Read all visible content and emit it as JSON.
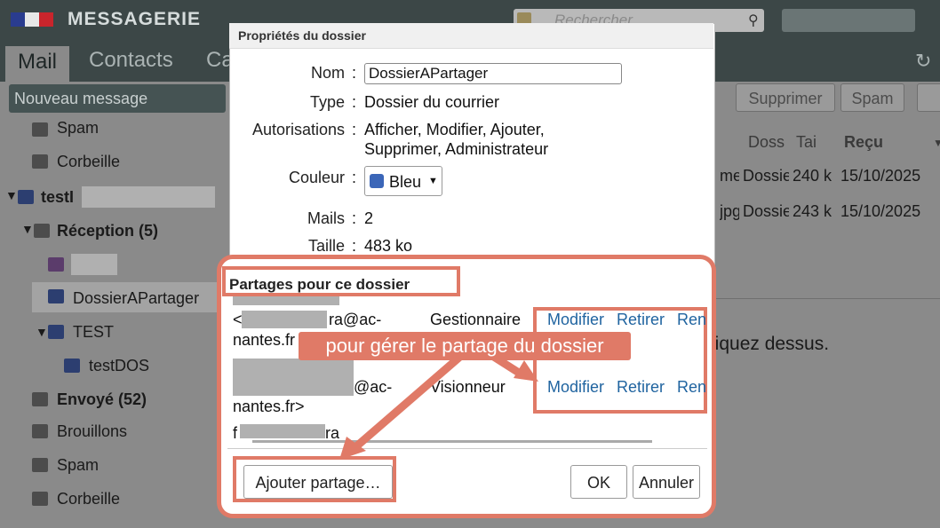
{
  "header": {
    "app_title": "MESSAGERIE",
    "search_placeholder": "Rechercher",
    "tabs": [
      {
        "label": "Mail"
      },
      {
        "label": "Contacts"
      },
      {
        "label": "Ca"
      }
    ],
    "refresh_icon": "refresh-icon"
  },
  "toolbar": {
    "compose_label": "Nouveau message",
    "delete_label": "Supprimer",
    "spam_label": "Spam"
  },
  "folders": {
    "spam_top": "Spam",
    "trash_top": "Corbeille",
    "account_label": "testI",
    "inbox_label": "Réception (5)",
    "shared_folder": "DossierAPartager",
    "test_folder": "TEST",
    "test_sub": "testDOS",
    "sent_label": "Envoyé (52)",
    "drafts_label": "Brouillons",
    "spam_label": "Spam",
    "trash_label": "Corbeille"
  },
  "message_list": {
    "columns": [
      "Doss",
      "Tai",
      "Reçu"
    ],
    "rows": [
      {
        "prefix": "me",
        "folder": "Dossie",
        "size": "240 k",
        "date": "15/10/2025"
      },
      {
        "prefix": "jpg",
        "folder": "Dossie",
        "size": "243 k",
        "date": "15/10/2025"
      }
    ],
    "hint_text": "liquez dessus."
  },
  "dialog": {
    "title": "Propriétés du dossier",
    "name_label": "Nom",
    "name_value": "DossierAPartager",
    "type_label": "Type",
    "type_value": "Dossier du courrier",
    "perm_label": "Autorisations",
    "perm_line1": "Afficher, Modifier, Ajouter,",
    "perm_line2": "Supprimer, Administrateur",
    "color_label": "Couleur",
    "color_value": "Bleu",
    "mails_label": "Mails",
    "mails_value": "2",
    "size_label": "Taille",
    "size_value": "483 ko",
    "colon": ":"
  },
  "sharing": {
    "title": "Partages pour ce dossier",
    "entries": [
      {
        "email_start": "<",
        "email_end": "ra@ac-",
        "email_line2": "nantes.fr",
        "role": "Gestionnaire",
        "modify": "Modifier",
        "remove": "Retirer",
        "rename": "Ren"
      },
      {
        "email_start": "f",
        "email_end": "@ac-",
        "email_line2": "nantes.fr>",
        "role": "Visionneur",
        "modify": "Modifier",
        "remove": "Retirer",
        "rename": "Ren"
      },
      {
        "email_start": "f",
        "email_end": "ra"
      }
    ],
    "callout": "pour gérer le partage du dossier",
    "add_label": "Ajouter partage…",
    "ok_label": "OK",
    "cancel_label": "Annuler"
  },
  "colors": {
    "accent": "#e07a67",
    "link": "#2064a0",
    "header": "#3c4747"
  }
}
